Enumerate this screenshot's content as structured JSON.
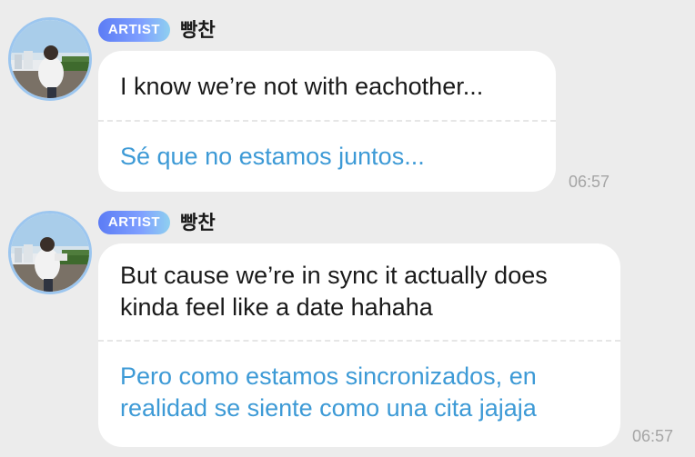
{
  "messages": [
    {
      "badge": "ARTIST",
      "name": "빵찬",
      "original": "I know we’re not with eachother...",
      "translation": "Sé que no estamos juntos...",
      "time": "06:57"
    },
    {
      "badge": "ARTIST",
      "name": "빵찬",
      "original": "But cause we’re in sync it actually does kinda feel like a date hahaha",
      "translation": "Pero como estamos sincronizados, en realidad se siente como una cita jajaja",
      "time": "06:57"
    }
  ],
  "colors": {
    "background": "#ececec",
    "bubble": "#ffffff",
    "translation_text": "#3d9ad6",
    "avatar_ring": "#9cc6ef",
    "badge_gradient": [
      "#5c7cf5",
      "#8fd0f0"
    ]
  }
}
